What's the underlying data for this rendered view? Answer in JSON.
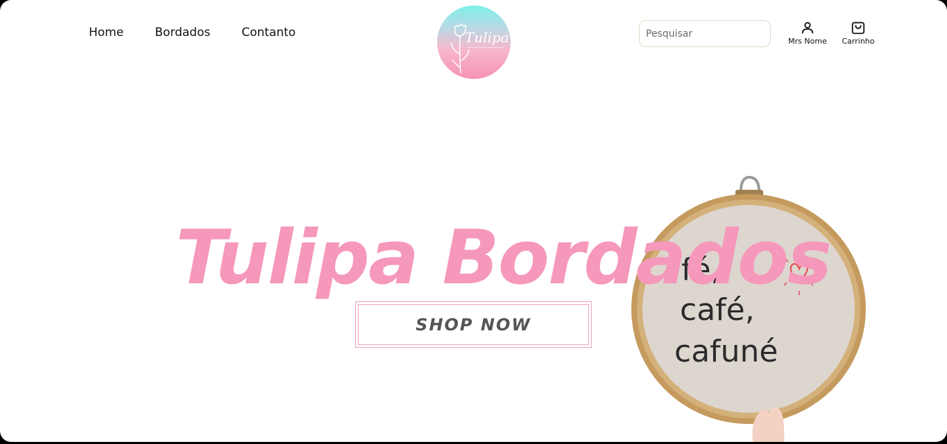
{
  "nav": {
    "items": [
      "Home",
      "Bordados",
      "Contanto"
    ]
  },
  "logo": {
    "text": "Tulipa"
  },
  "search": {
    "placeholder": "Pesquisar"
  },
  "user": {
    "label": "Mrs Nome"
  },
  "cart": {
    "label": "Carrinho"
  },
  "hero": {
    "title": "Tulipa Bordados",
    "button_label": "SHOP NOW",
    "embroidery_lines": [
      "fé,",
      "café,",
      "cafuné"
    ]
  },
  "colors": {
    "accent": "#f598bb",
    "border": "#f0a3c0"
  },
  "icons": {
    "user": "user-icon",
    "cart": "shopping-bag-icon"
  }
}
